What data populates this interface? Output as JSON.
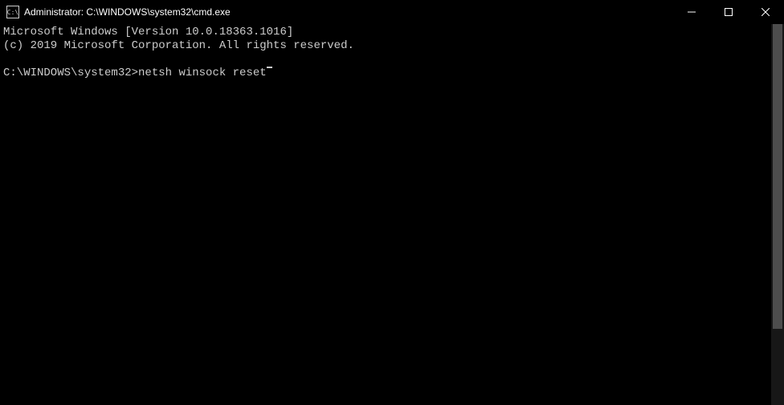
{
  "titlebar": {
    "icon_label": "C:\\",
    "title": "Administrator: C:\\WINDOWS\\system32\\cmd.exe"
  },
  "terminal": {
    "line1": "Microsoft Windows [Version 10.0.18363.1016]",
    "line2": "(c) 2019 Microsoft Corporation. All rights reserved.",
    "blank": "",
    "prompt": "C:\\WINDOWS\\system32>",
    "command": "netsh winsock reset"
  }
}
